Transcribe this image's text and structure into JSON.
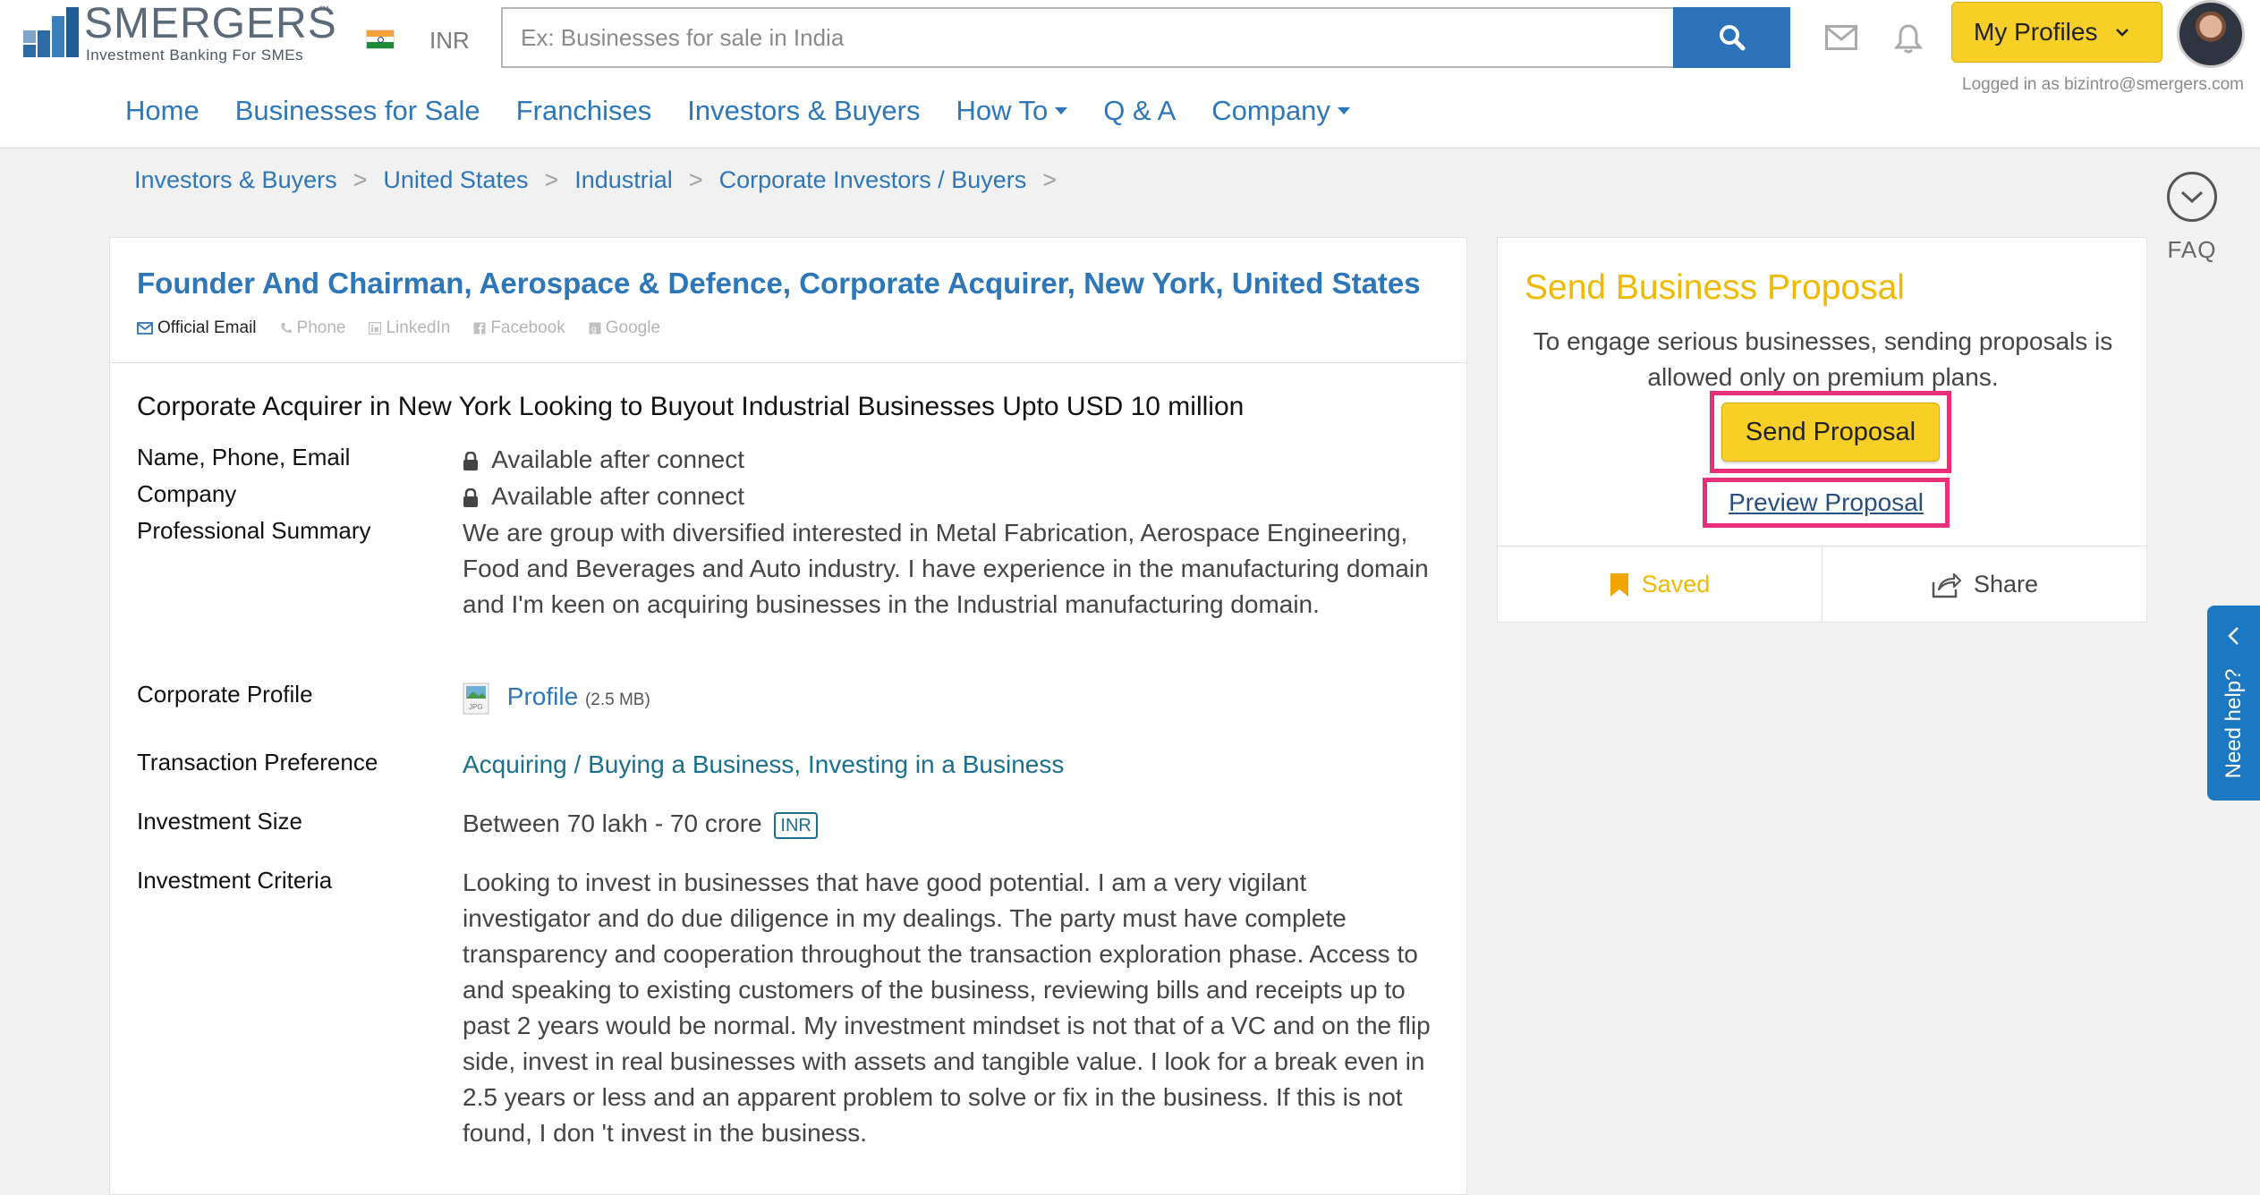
{
  "header": {
    "logo_text": "SMERGERS",
    "logo_tm": "™",
    "logo_tagline": "Investment Banking For SMEs",
    "currency": "INR",
    "search_placeholder": "Ex: Businesses for sale in India",
    "profiles_label": "My Profiles",
    "logged_in": "Logged in as bizintro@smergers.com",
    "nav": [
      {
        "label": "Home"
      },
      {
        "label": "Businesses for Sale"
      },
      {
        "label": "Franchises"
      },
      {
        "label": "Investors & Buyers"
      },
      {
        "label": "How To"
      },
      {
        "label": "Q & A"
      },
      {
        "label": "Company"
      }
    ]
  },
  "breadcrumb": [
    "Investors & Buyers",
    "United States",
    "Industrial",
    "Corporate Investors / Buyers"
  ],
  "breadcrumb_sep": ">",
  "faq_label": "FAQ",
  "profile": {
    "title": "Founder And Chairman, Aerospace & Defence, Corporate Acquirer, New York, United States",
    "contacts": [
      "Official Email",
      "Phone",
      "LinkedIn",
      "Facebook",
      "Google"
    ],
    "headline": "Corporate Acquirer in New York Looking to Buyout Industrial Businesses Upto USD 10 million",
    "fields": {
      "name_label": "Name, Phone, Email",
      "name_value": "Available after connect",
      "company_label": "Company",
      "company_value": "Available after connect",
      "summary_label": "Professional Summary",
      "summary_value": "We are group with diversified interested in Metal Fabrication, Aerospace Engineering, Food and Beverages and Auto industry. I have experience in the manufacturing domain and I'm keen on acquiring businesses in the Industrial manufacturing domain.",
      "corp_label": "Corporate Profile",
      "corp_link": "Profile",
      "corp_size": "(2.5 MB)",
      "file_type": "JPG",
      "txn_label": "Transaction Preference",
      "txn_value": "Acquiring / Buying a Business, Investing in a Business",
      "inv_size_label": "Investment Size",
      "inv_size_value": "Between 70 lakh - 70 crore",
      "inv_size_badge": "INR",
      "criteria_label": "Investment Criteria",
      "criteria_value": "Looking to invest in businesses that have good potential. I am a very vigilant investigator and do due diligence in my dealings. The party must have complete transparency and cooperation throughout the transaction exploration phase. Access to and speaking to existing customers of the business, reviewing bills and receipts up to past 2 years would be normal. My investment mindset is not that of a VC and on the flip side, invest in real businesses with assets and tangible value. I look for a break even in 2.5 years or less and an apparent problem to solve or fix in the business. If this is not found, I don 't invest in the business."
    }
  },
  "proposal": {
    "title": "Send Business Proposal",
    "text": "To engage serious businesses, sending proposals is allowed only on premium plans.",
    "send_label": "Send Proposal",
    "preview_label": "Preview Proposal",
    "saved_label": "Saved",
    "share_label": "Share"
  },
  "help_label": "Need help?",
  "colors": {
    "brand_blue": "#2d76b8",
    "accent_yellow": "#f7cf27",
    "highlight_pink": "#e8307a"
  }
}
